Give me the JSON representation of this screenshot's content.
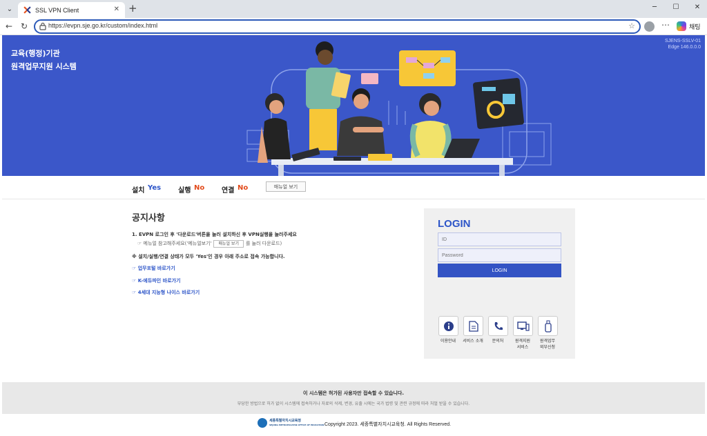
{
  "browser": {
    "tab_title": "SSL VPN Client",
    "url": "https://evpn.sje.go.kr/custom/index.html",
    "copilot_label": "채팅"
  },
  "hero": {
    "title_line1": "교육(행정)기관",
    "title_line2": "원격업무지원 시스템",
    "version_line1": "SJENS-SSLV-01",
    "version_line2": "Edge 146.0.0.0"
  },
  "status": {
    "install_label": "설치",
    "install_value": "Yes",
    "run_label": "실행",
    "run_value": "No",
    "connect_label": "연결",
    "connect_value": "No",
    "manual_button": "매뉴얼 보기",
    "colors": {
      "yes": "#2d55c8",
      "no": "#e24a1a"
    }
  },
  "notice": {
    "title": "공지사항",
    "line1": "1. EVPN 로그인 후 '다운로드'버튼을 눌러 설치하신 후 VPN실행을 눌러주세요",
    "sub1_prefix": "☞ 메뉴얼 참고해주세요('메뉴얼보기'",
    "sub1_button": "매뉴얼 보기",
    "sub1_suffix": "를 눌러 다운로드)",
    "line2": "※ 설치/실행/연결 상태가 모두 'Yes'인 경우 아래 주소로 접속 가능합니다.",
    "links": [
      "☞ 업무포털 바로가기",
      "☞ K-에듀파인 바로가기",
      "☞ 4세대 지능형 나이스 바로가기"
    ]
  },
  "login": {
    "title": "LOGIN",
    "id_placeholder": "ID",
    "password_placeholder": "Password",
    "button": "LOGIN"
  },
  "services": [
    {
      "icon": "info-icon",
      "label": "이용안내"
    },
    {
      "icon": "document-icon",
      "label": "서비스 소개"
    },
    {
      "icon": "phone-icon",
      "label": "문의처"
    },
    {
      "icon": "remote-computer-icon",
      "label": "원격지원\n서비스"
    },
    {
      "icon": "usb-icon",
      "label": "원격업무\n외부신청"
    }
  ],
  "footer": {
    "main": "이 시스템은 허가된 사용자만 접속할 수 있습니다.",
    "sub": "부당한 방법으로 허가 없이 시스템에 접속하거나 자료의 삭제, 변경, 유출 시에는 국가 법령 및 관련 규정에 따라 처벌 받을 수 있습니다.",
    "logo_text_line1": "세종특별자치시교육청",
    "logo_text_line2": "SEJONG METROPOLITAN OFFICE OF EDUCATION",
    "copyright": "Copyright 2023. 세종특별자치시교육청. All Rights Reserved."
  }
}
